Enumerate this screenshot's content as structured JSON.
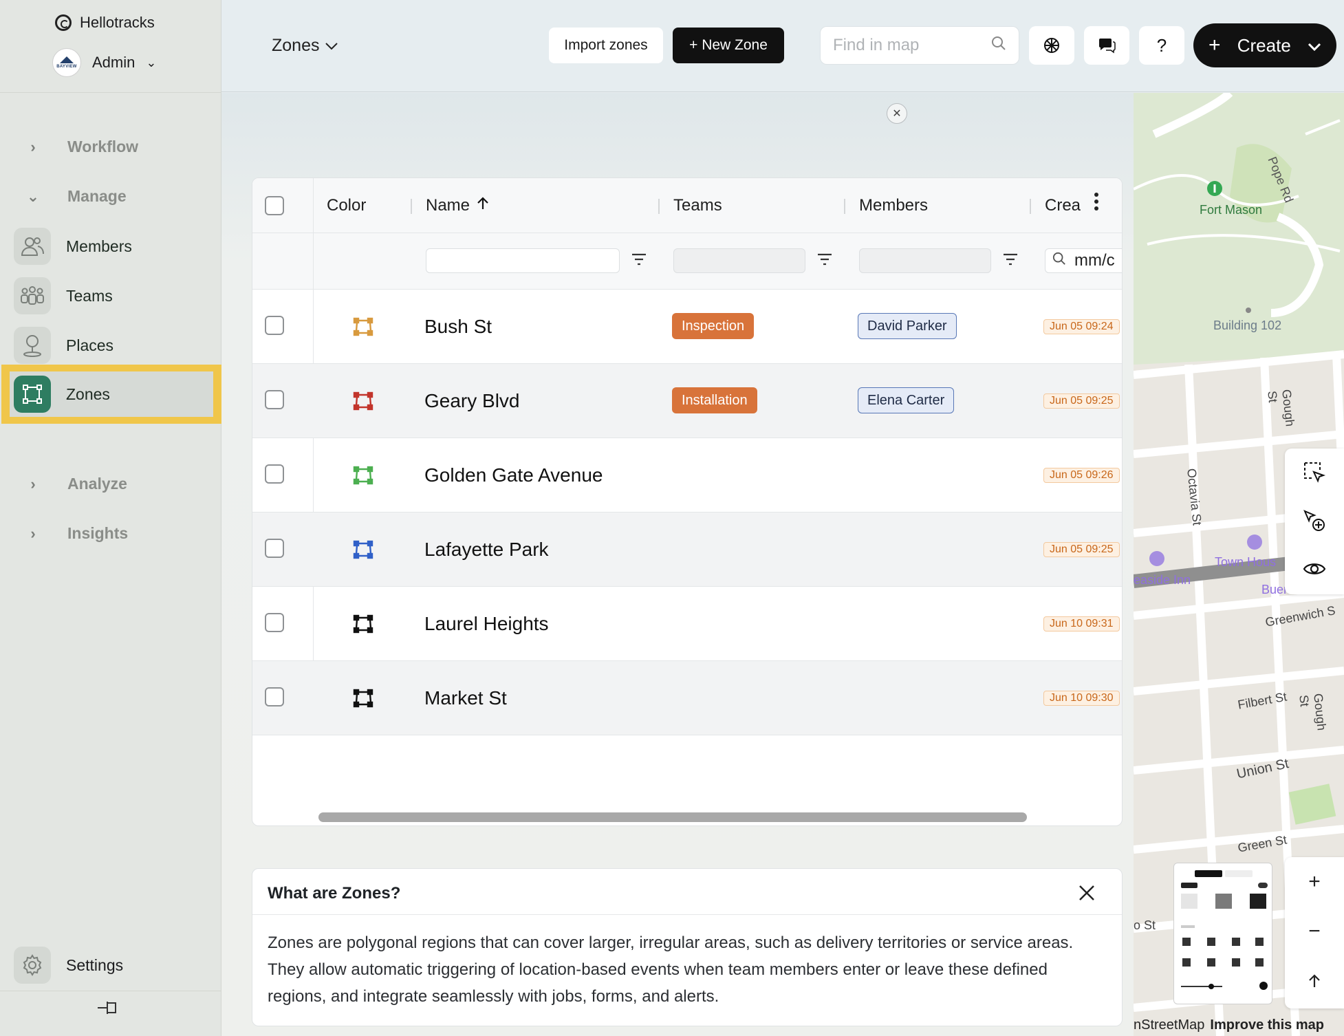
{
  "sidebar": {
    "brand": "Hellotracks",
    "account": "Admin",
    "avatar_text": "BAYVIEW",
    "groups": [
      {
        "label": "Workflow",
        "expanded": false
      },
      {
        "label": "Manage",
        "expanded": true
      },
      {
        "label": "Analyze",
        "expanded": false
      },
      {
        "label": "Insights",
        "expanded": false
      }
    ],
    "items": [
      {
        "label": "Members",
        "icon": "members-icon"
      },
      {
        "label": "Teams",
        "icon": "teams-icon"
      },
      {
        "label": "Places",
        "icon": "place-pin-icon"
      },
      {
        "label": "Zones",
        "icon": "zone-icon",
        "active": true
      }
    ],
    "settings_label": "Settings",
    "highlight_color": "#f0c64a",
    "active_icon_color": "#2e7d61"
  },
  "topbar": {
    "section_dropdown": "Zones",
    "import_label": "Import zones",
    "new_zone_label": "+ New Zone",
    "search_placeholder": "Find in map",
    "help_label": "?",
    "create_label": "Create"
  },
  "table": {
    "columns": [
      "Color",
      "Name",
      "Teams",
      "Members",
      "Crea"
    ],
    "sort": {
      "column": "Name",
      "direction": "ascending"
    },
    "date_filter_placeholder": "mm/c",
    "rows": [
      {
        "name": "Bush St",
        "color": "#d89a3e",
        "team": "Inspection",
        "team_color": "#d8733a",
        "member": "David Parker",
        "created": "Jun 05 09:24"
      },
      {
        "name": "Geary Blvd",
        "color": "#c2342b",
        "team": "Installation",
        "team_color": "#d8733a",
        "member": "Elena Carter",
        "created": "Jun 05 09:25"
      },
      {
        "name": "Golden Gate Avenue",
        "color": "#4caf50",
        "team": "",
        "member": "",
        "created": "Jun 05 09:26"
      },
      {
        "name": "Lafayette Park",
        "color": "#3060c8",
        "team": "",
        "member": "",
        "created": "Jun 05 09:25"
      },
      {
        "name": "Laurel Heights",
        "color": "#111111",
        "team": "",
        "member": "",
        "created": "Jun 10 09:31"
      },
      {
        "name": "Market St",
        "color": "#111111",
        "team": "",
        "member": "",
        "created": "Jun 10 09:30"
      }
    ]
  },
  "info": {
    "title": "What are Zones?",
    "body": "Zones are polygonal regions that can cover larger, irregular areas, such as delivery territories or service areas. They allow automatic triggering of location-based events when team members enter or leave these defined regions, and integrate seamlessly with jobs, forms, and alerts."
  },
  "map": {
    "labels": {
      "fort_mason": "Fort Mason",
      "pope_rd": "Pope Rd",
      "building": "Building 102",
      "gough_1": "Gough St",
      "octavia": "Octavia St",
      "town_house": "Town Hous",
      "seaside": "easide Inn",
      "buena": "Buena Vista M",
      "greenwich": "Greenwich S",
      "filbert": "Filbert St",
      "gough_2": "Gough St",
      "union": "Union St",
      "green": "Green St",
      "partial_st": "o St"
    },
    "attribution": "nStreetMap",
    "improve_link": "Improve this map",
    "zoom_in": "+",
    "zoom_out": "−"
  }
}
